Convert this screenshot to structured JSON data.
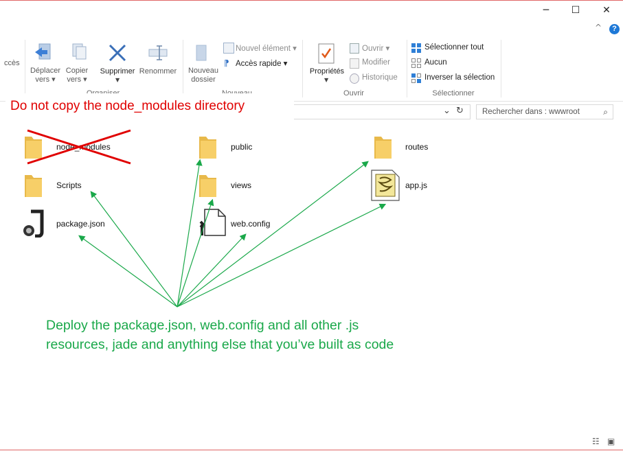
{
  "titlebar": {
    "minimize": "─",
    "maximize": "☐",
    "close": "✕",
    "collapse": "^",
    "help": "?"
  },
  "left_cut_label": "ccès",
  "ribbon": {
    "organiser": {
      "move_to": [
        "Déplacer",
        "vers ▾"
      ],
      "copy_to": [
        "Copier",
        "vers ▾"
      ],
      "delete": "Supprimer",
      "rename": "Renommer",
      "group": "Organiser"
    },
    "nouveau": {
      "new_folder": [
        "Nouveau",
        "dossier"
      ],
      "new_item": "Nouvel élément ▾",
      "quick_access": "Accès rapide ▾",
      "group": "Nouveau"
    },
    "ouvrir": {
      "properties": "Propriétés",
      "open": "Ouvrir ▾",
      "edit": "Modifier",
      "history": "Historique",
      "group": "Ouvrir"
    },
    "selectionner": {
      "select_all": "Sélectionner tout",
      "select_none": "Aucun",
      "invert": "Inverser la sélection",
      "group": "Sélectionner"
    }
  },
  "addressbar": {
    "dropdown_icon": "⌄",
    "refresh_icon": "↻"
  },
  "search": {
    "placeholder": "Rechercher dans : wwwroot",
    "icon": "⌕"
  },
  "annotation_red": "Do not copy the node_modules directory",
  "files": [
    {
      "name": "node_modules",
      "type": "folder"
    },
    {
      "name": "Scripts",
      "type": "folder"
    },
    {
      "name": "package.json",
      "type": "json"
    },
    {
      "name": "public",
      "type": "folder"
    },
    {
      "name": "views",
      "type": "folder"
    },
    {
      "name": "web.config",
      "type": "config"
    },
    {
      "name": "routes",
      "type": "folder"
    },
    {
      "name": "app.js",
      "type": "script"
    }
  ],
  "annotation_green": [
    "Deploy the package.json, web.config and all other .js",
    "resources, jade and anything else that you’ve built as code"
  ],
  "colors": {
    "red": "#e00000",
    "green": "#1aa84a",
    "folder": "#f5c75a",
    "accent": "#1e78d7"
  },
  "status_icons": {
    "details_view": "☷",
    "large_icons": "▣"
  }
}
